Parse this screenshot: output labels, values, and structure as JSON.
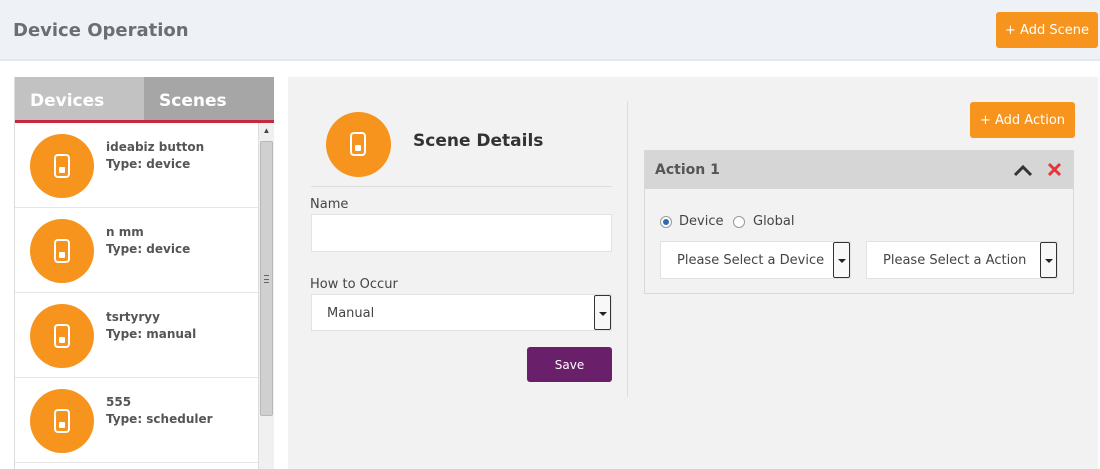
{
  "header": {
    "title": "Device Operation",
    "add_scene_label": "+ Add Scene"
  },
  "colors": {
    "accent": "#f7941d",
    "save": "#6a1f6a",
    "tab_underline": "#c8283e",
    "close": "#e5343b"
  },
  "left_panel": {
    "tabs": [
      {
        "label": "Devices",
        "active": false
      },
      {
        "label": "Scenes",
        "active": true
      }
    ],
    "scenes": [
      {
        "name": "ideabiz button",
        "type": "Type: device",
        "icon": "switch-icon"
      },
      {
        "name": "n mm",
        "type": "Type: device",
        "icon": "switch-icon"
      },
      {
        "name": "tsrtyryy",
        "type": "Type: manual",
        "icon": "switch-icon"
      },
      {
        "name": "555",
        "type": "Type: scheduler",
        "icon": "switch-icon"
      }
    ]
  },
  "scene_details": {
    "title": "Scene Details",
    "name_label": "Name",
    "name_value": "",
    "occur_label": "How to Occur",
    "occur_value": "Manual",
    "save_label": "Save"
  },
  "actions": {
    "add_action_label": "+ Add Action",
    "items": [
      {
        "title": "Action 1",
        "radio_device_label": "Device",
        "radio_global_label": "Global",
        "selected_radio": "Device",
        "device_select_value": "Please Select a Device",
        "action_select_value": "Please Select a Action"
      }
    ]
  }
}
